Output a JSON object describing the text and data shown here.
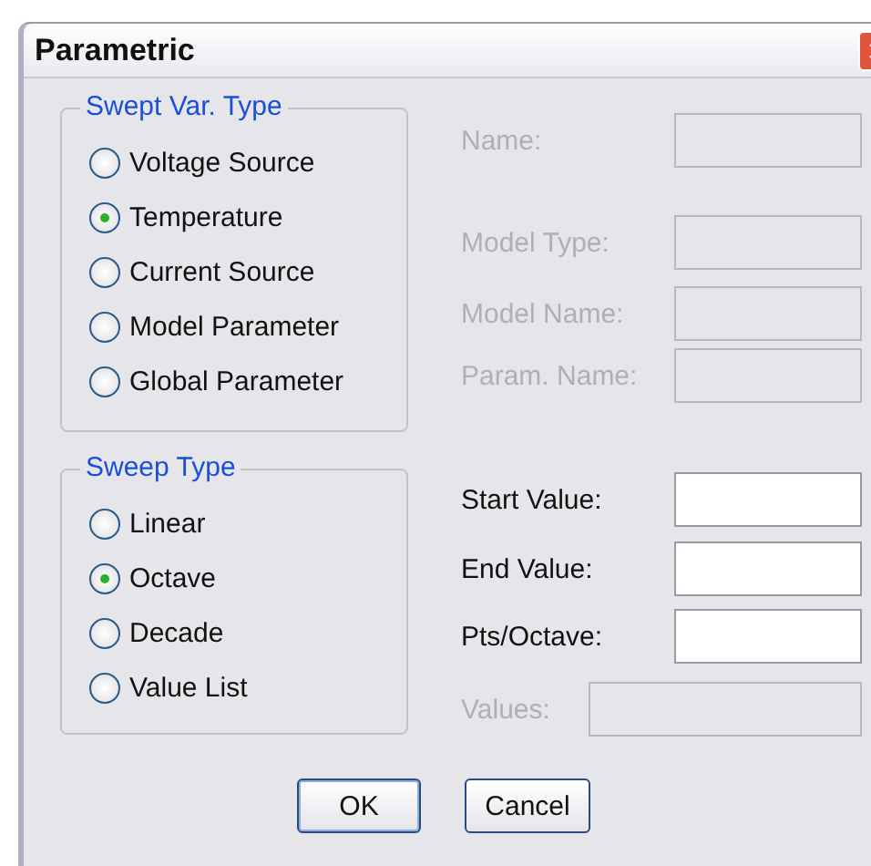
{
  "window": {
    "title": "Parametric"
  },
  "swept_var_type": {
    "title": "Swept Var. Type",
    "options": [
      {
        "label": "Voltage Source",
        "selected": false
      },
      {
        "label": "Temperature",
        "selected": true
      },
      {
        "label": "Current Source",
        "selected": false
      },
      {
        "label": "Model Parameter",
        "selected": false
      },
      {
        "label": "Global Parameter",
        "selected": false
      }
    ]
  },
  "sweep_type": {
    "title": "Sweep Type",
    "options": [
      {
        "label": "Linear",
        "selected": false
      },
      {
        "label": "Octave",
        "selected": true
      },
      {
        "label": "Decade",
        "selected": false
      },
      {
        "label": "Value List",
        "selected": false
      }
    ]
  },
  "fields": [
    {
      "label": "Name:",
      "disabled": true,
      "kind": "short"
    },
    {
      "label": "Model Type:",
      "disabled": true,
      "kind": "short"
    },
    {
      "label": "Model Name:",
      "disabled": true,
      "kind": "short"
    },
    {
      "label": "Param. Name:",
      "disabled": true,
      "kind": "short"
    },
    {
      "label": "Start Value:",
      "disabled": false,
      "kind": "short"
    },
    {
      "label": "End Value:",
      "disabled": false,
      "kind": "short"
    },
    {
      "label": "Pts/Octave:",
      "disabled": false,
      "kind": "short"
    },
    {
      "label": "Values:",
      "disabled": true,
      "kind": "wide"
    }
  ],
  "buttons": [
    {
      "label": "OK",
      "kind": "default"
    },
    {
      "label": "Cancel",
      "kind": "normal"
    }
  ]
}
